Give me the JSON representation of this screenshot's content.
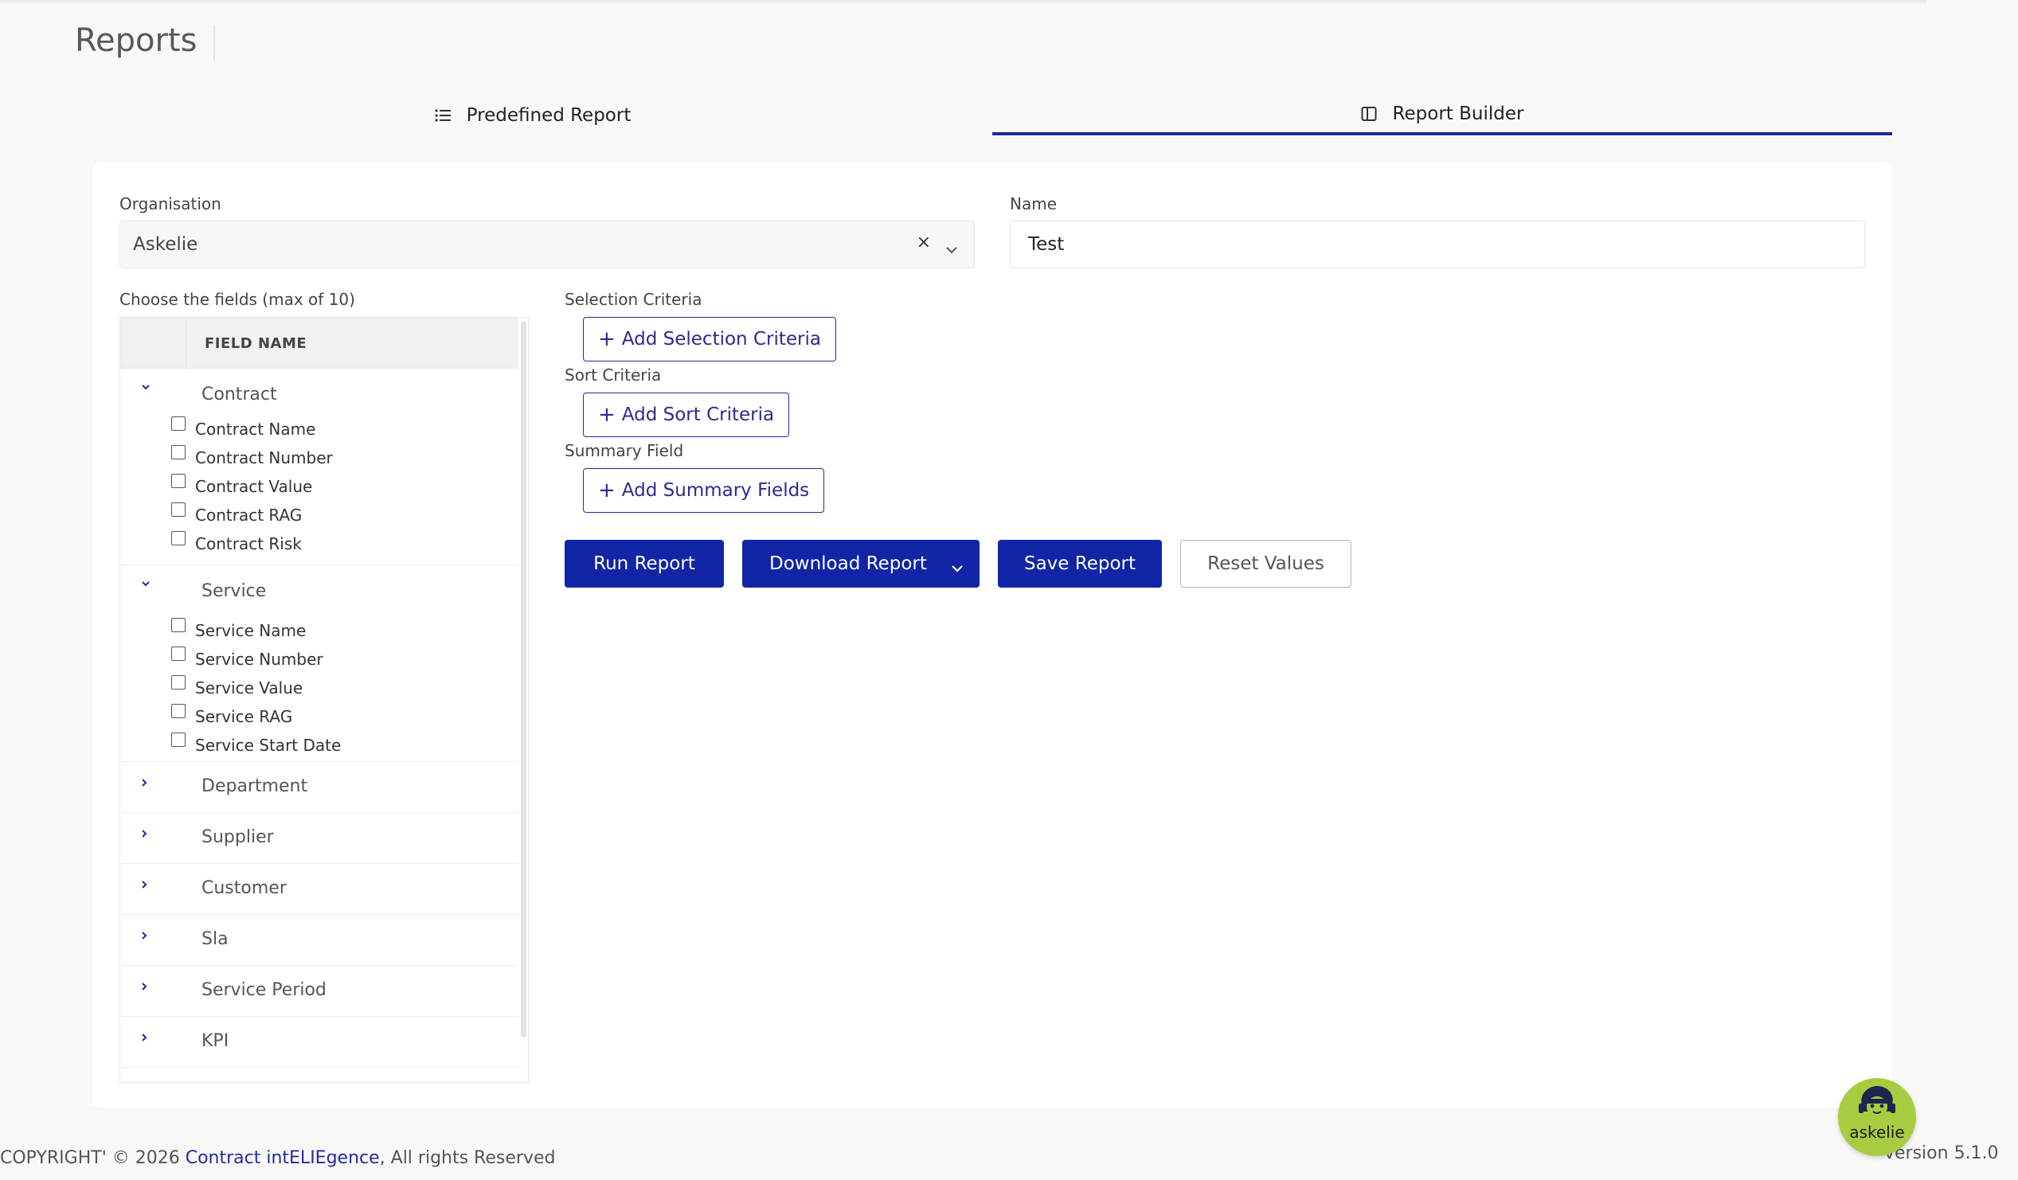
{
  "page": {
    "title": "Reports"
  },
  "tabs": [
    {
      "label": "Predefined Report",
      "icon": "list-icon",
      "active": false
    },
    {
      "label": "Report Builder",
      "icon": "columns-icon",
      "active": true
    }
  ],
  "form": {
    "organisation_label": "Organisation",
    "organisation_value": "Askelie",
    "clear_symbol": "×",
    "name_label": "Name",
    "name_value": "Test",
    "fields_label": "Choose the fields (max of 10)"
  },
  "tree": {
    "header": "FIELD NAME",
    "groups": [
      {
        "name": "Contract",
        "expanded": true,
        "fields": [
          "Contract Name",
          "Contract Number",
          "Contract Value",
          "Contract RAG",
          "Contract Risk"
        ]
      },
      {
        "name": "Service",
        "expanded": true,
        "fields": [
          "Service Name",
          "Service Number",
          "Service Value",
          "Service RAG",
          "Service Start Date"
        ]
      },
      {
        "name": "Department",
        "expanded": false
      },
      {
        "name": "Supplier",
        "expanded": false
      },
      {
        "name": "Customer",
        "expanded": false
      },
      {
        "name": "Sla",
        "expanded": false
      },
      {
        "name": "Service Period",
        "expanded": false
      },
      {
        "name": "KPI",
        "expanded": false
      }
    ]
  },
  "criteria": {
    "selection_label": "Selection Criteria",
    "selection_button": "Add Selection Criteria",
    "sort_label": "Sort Criteria",
    "sort_button": "Add Sort Criteria",
    "summary_label": "Summary Field",
    "summary_button": "Add Summary Fields",
    "plus": "+"
  },
  "actions": {
    "run": "Run Report",
    "download": "Download Report",
    "save": "Save Report",
    "reset": "Reset Values"
  },
  "footer": {
    "copyright_prefix": "COPYRIGHT' © 2026 ",
    "brand_link": "Contract intELIEgence",
    "copyright_suffix": ", All rights Reserved",
    "version": "version 5.1.0",
    "assistant_label": "askelie"
  },
  "colors": {
    "primary": "#1125a6",
    "tab_underline": "#1c2a94",
    "link": "#1f2d9a",
    "assistant_bg": "#a8cc3f"
  }
}
